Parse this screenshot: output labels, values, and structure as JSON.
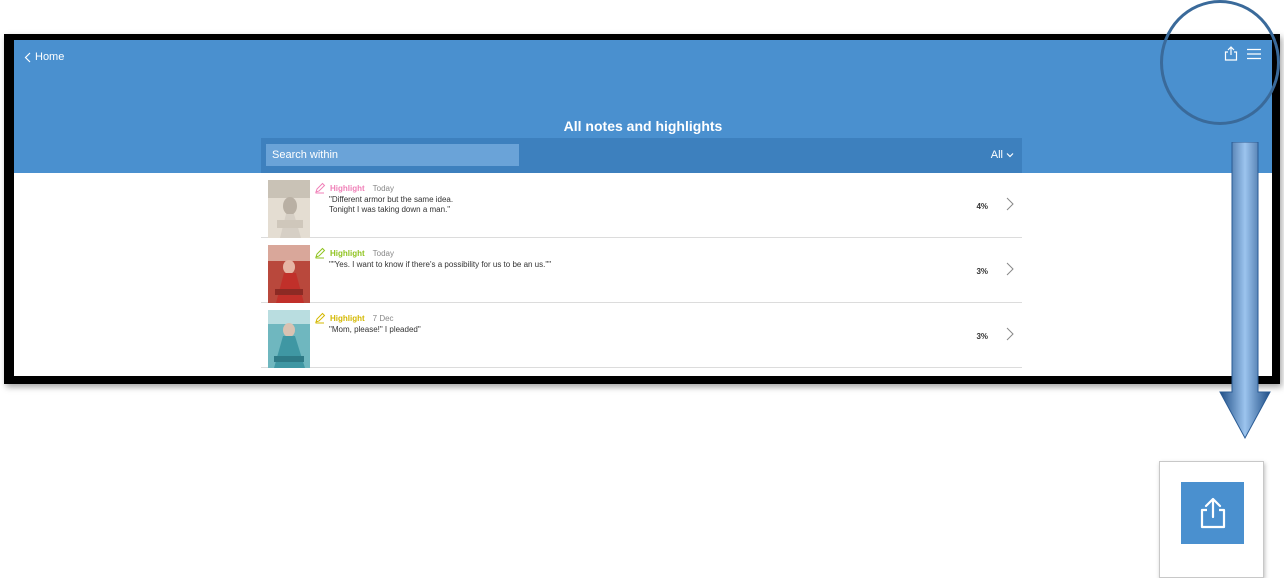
{
  "nav": {
    "back_label": "Home"
  },
  "page": {
    "title": "All notes and highlights"
  },
  "search": {
    "placeholder": "Search within"
  },
  "filter": {
    "label": "All"
  },
  "colors": {
    "banner": "#4a90cf",
    "search_bar": "#3d80be",
    "annotation": "#3a6a9a"
  },
  "entries": [
    {
      "type": "Highlight",
      "date": "Today",
      "text": "\"Different armor but the same idea.\nTonight I was taking down a man.\"",
      "percent": "4%",
      "color": "#f080b8"
    },
    {
      "type": "Highlight",
      "date": "Today",
      "text": "\"\"Yes. I want to know if there's a possibility for us to be an us.\"\"",
      "percent": "3%",
      "color": "#8fc31f"
    },
    {
      "type": "Highlight",
      "date": "7 Dec",
      "text": "\"Mom, please!\" I pleaded\"",
      "percent": "3%",
      "color": "#d4b800"
    }
  ]
}
